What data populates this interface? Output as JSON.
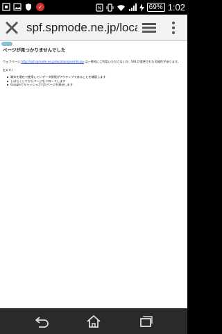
{
  "status_bar": {
    "battery": "69%",
    "time": "1:02"
  },
  "toolbar": {
    "url": "spf.spmode.ne.jp/location"
  },
  "page": {
    "title": "ページが見つかりませんでした",
    "desc_prefix": "ウェブページ",
    "desc_link": "http://spf.spmode.ne.jp/location/posinfo.jsp",
    "desc_suffix": "は一時的にご利用いただけないか、URLが変更された可能性があります。",
    "hint_label": "ヒント:",
    "hints": [
      "端末を現在で使用していデータ接続がアクティブであることを確認します",
      "しばらくしてからページをリロードします",
      "Googleでキャッシュされたページを表示します"
    ]
  },
  "colors": {
    "toolbar_bg": "#f2f2f2",
    "link": "#2a4fd6",
    "nav_bg": "#2a2a2a"
  }
}
